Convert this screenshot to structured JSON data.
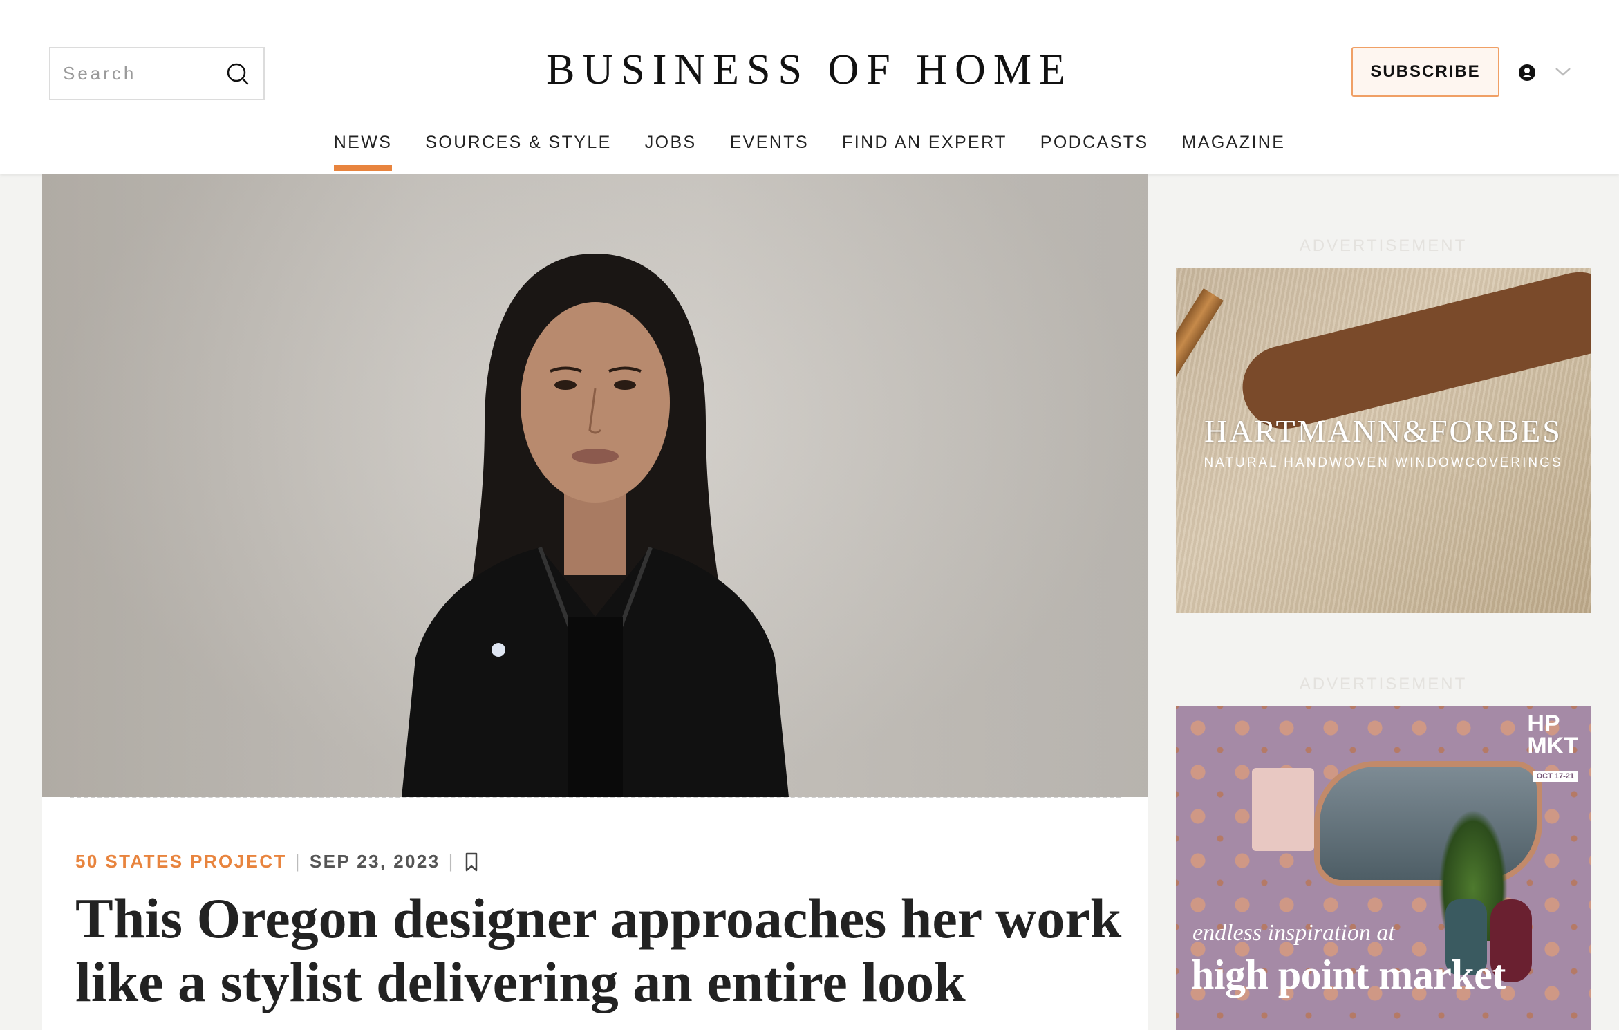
{
  "header": {
    "logo": "BUSINESS OF HOME",
    "search_placeholder": "Search",
    "subscribe_label": "SUBSCRIBE",
    "accent_color": "#e8843e"
  },
  "nav": {
    "items": [
      {
        "label": "NEWS",
        "active": true
      },
      {
        "label": "SOURCES & STYLE",
        "active": false
      },
      {
        "label": "JOBS",
        "active": false
      },
      {
        "label": "EVENTS",
        "active": false
      },
      {
        "label": "FIND AN EXPERT",
        "active": false
      },
      {
        "label": "PODCASTS",
        "active": false
      },
      {
        "label": "MAGAZINE",
        "active": false
      }
    ]
  },
  "article": {
    "category": "50 STATES PROJECT",
    "date": "SEP 23, 2023",
    "headline": "This Oregon designer approaches her work like a stylist delivering an entire look"
  },
  "sidebar": {
    "ad_label_1": "ADVERTISEMENT",
    "ad1_brand": "HARTMANN&FORBES",
    "ad1_tagline": "NATURAL HANDWOVEN WINDOWCOVERINGS",
    "ad_label_2": "ADVERTISEMENT",
    "ad2_logo_line1": "HP",
    "ad2_logo_line2": "MKT",
    "ad2_dates": "OCT 17-21",
    "ad2_line1": "endless inspiration at",
    "ad2_line2": "high point market"
  }
}
